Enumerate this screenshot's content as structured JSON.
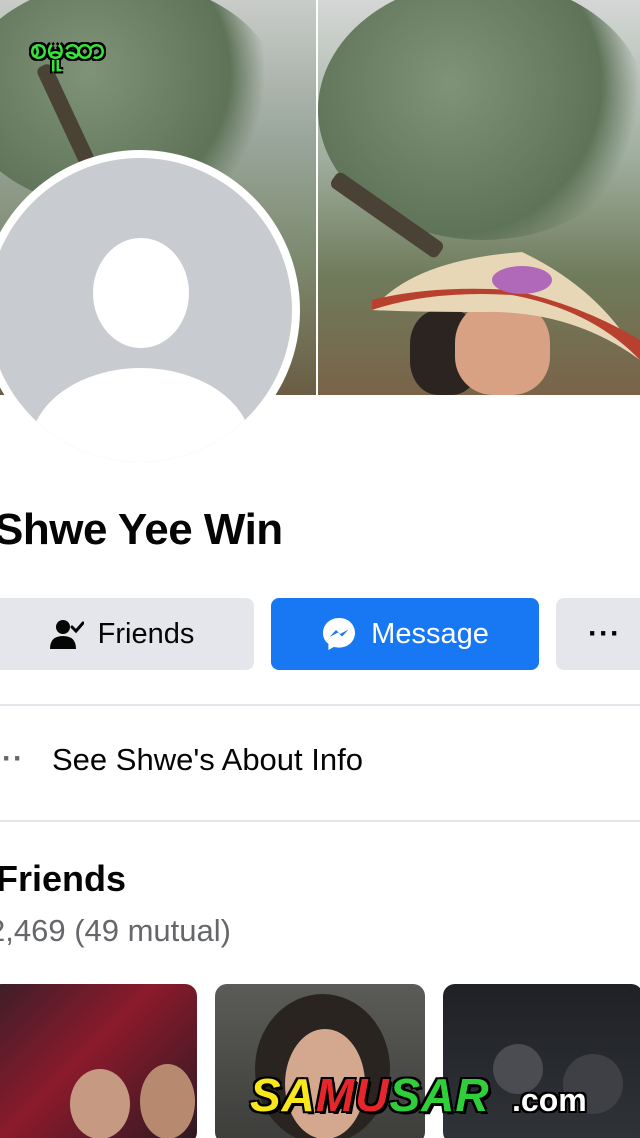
{
  "cover": {
    "watermark_text": "စမူဆာ"
  },
  "profile": {
    "name": "Shwe Yee Win"
  },
  "actions": {
    "friends_label": "Friends",
    "message_label": "Message",
    "more_label": "···"
  },
  "about": {
    "label": "See Shwe's About Info"
  },
  "friends_section": {
    "title": "Friends",
    "count_text": "2,469 (49 mutual)"
  },
  "watermark": {
    "part1": "SA",
    "part2": "MU",
    "part3": "SAR",
    "suffix": ".com"
  },
  "colors": {
    "accent": "#1877f2",
    "button_gray": "#e4e6eb",
    "secondary_text": "#65676b"
  }
}
